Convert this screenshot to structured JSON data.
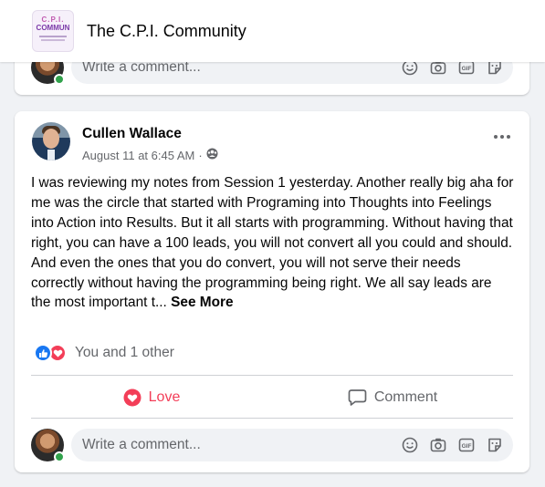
{
  "group": {
    "name": "The C.P.I. Community",
    "logo_line1": "C.P.I.",
    "logo_line2": "COMMUN"
  },
  "composer": {
    "placeholder": "Write a comment...",
    "icons": [
      "emoji-icon",
      "camera-icon",
      "gif-icon",
      "sticker-icon"
    ]
  },
  "post": {
    "author": "Cullen Wallace",
    "timestamp": "August 11 at 6:45 AM",
    "separator": "·",
    "audience_icon": "group-audience-icon",
    "text": "I was reviewing my notes from Session 1 yesterday. Another really big aha for me was the circle that started with Programing into Thoughts into Feelings into Action into Results. But it all starts with programming. Without having that right, you can have a 100 leads, you will not convert all you could and should. And even the ones that you do convert, you will not serve their needs correctly without having the programming being right. We all say leads are the most important t...",
    "see_more": "See More",
    "reactions": {
      "types": [
        "like",
        "love"
      ],
      "summary": "You and 1 other"
    },
    "actions": {
      "love_label": "Love",
      "comment_label": "Comment"
    }
  },
  "colors": {
    "background": "#f0f2f5",
    "love": "#f33e58",
    "like": "#1877f2",
    "online": "#31a24c",
    "secondary_text": "#65676b"
  }
}
